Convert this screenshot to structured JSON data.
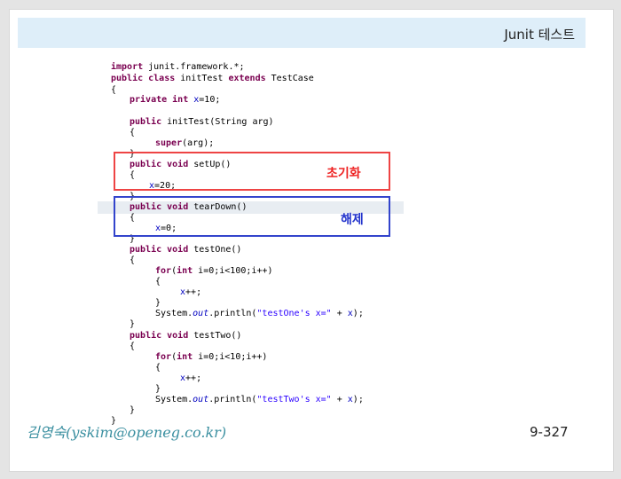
{
  "header": {
    "title": "Junit 테스트"
  },
  "code": {
    "l1a": "import",
    "l1b": " junit.framework.*;",
    "l2a": "public class",
    "l2b": " initTest ",
    "l2c": "extends",
    "l2d": " TestCase",
    "l3": "{",
    "l4a": "private int",
    "l4b": " x",
    "l4c": "=10;",
    "l5a": "public",
    "l5b": " initTest(String arg)",
    "l6": "{",
    "l7a": "super",
    "l7b": "(arg);",
    "l8": "}",
    "l9a": "public void",
    "l9b": " setUp()",
    "l10": "{",
    "l11a": "x",
    "l11b": "=20;",
    "l12": "}",
    "l13a": "public void",
    "l13b": " tearDown()",
    "l14": "{",
    "l15a": "x",
    "l15b": "=0;",
    "l16": "}",
    "l17a": "public void",
    "l17b": " testOne()",
    "l18": "{",
    "l19a": "for",
    "l19b": "(",
    "l19c": "int",
    "l19d": " i=0;i<100;i++)",
    "l20": "{",
    "l21a": "x",
    "l21b": "++;",
    "l22": "}",
    "l23a": "System.",
    "l23b": "out",
    "l23c": ".println(",
    "l23d": "\"testOne's x=\"",
    "l23e": " + ",
    "l23f": "x",
    "l23g": ");",
    "l24": "}",
    "l25a": "public void",
    "l25b": " testTwo()",
    "l26": "{",
    "l27a": "for",
    "l27b": "(",
    "l27c": "int",
    "l27d": " i=0;i<10;i++)",
    "l28": "{",
    "l29a": "x",
    "l29b": "++;",
    "l30": "}",
    "l31a": "System.",
    "l31b": "out",
    "l31c": ".println(",
    "l31d": "\"testTwo's x=\"",
    "l31e": " + ",
    "l31f": "x",
    "l31g": ");",
    "l32": "}",
    "l33": "}"
  },
  "annotations": {
    "init": "초기화",
    "release": "해제"
  },
  "footer": {
    "author": "김영숙(yskim@openeg.co.kr)",
    "page": "9-327"
  },
  "colors": {
    "keyword": "#7a0050",
    "field": "#0000c0",
    "red_box": "#ee4444",
    "blue_box": "#3344cc",
    "title_bar": "#deeef9"
  }
}
